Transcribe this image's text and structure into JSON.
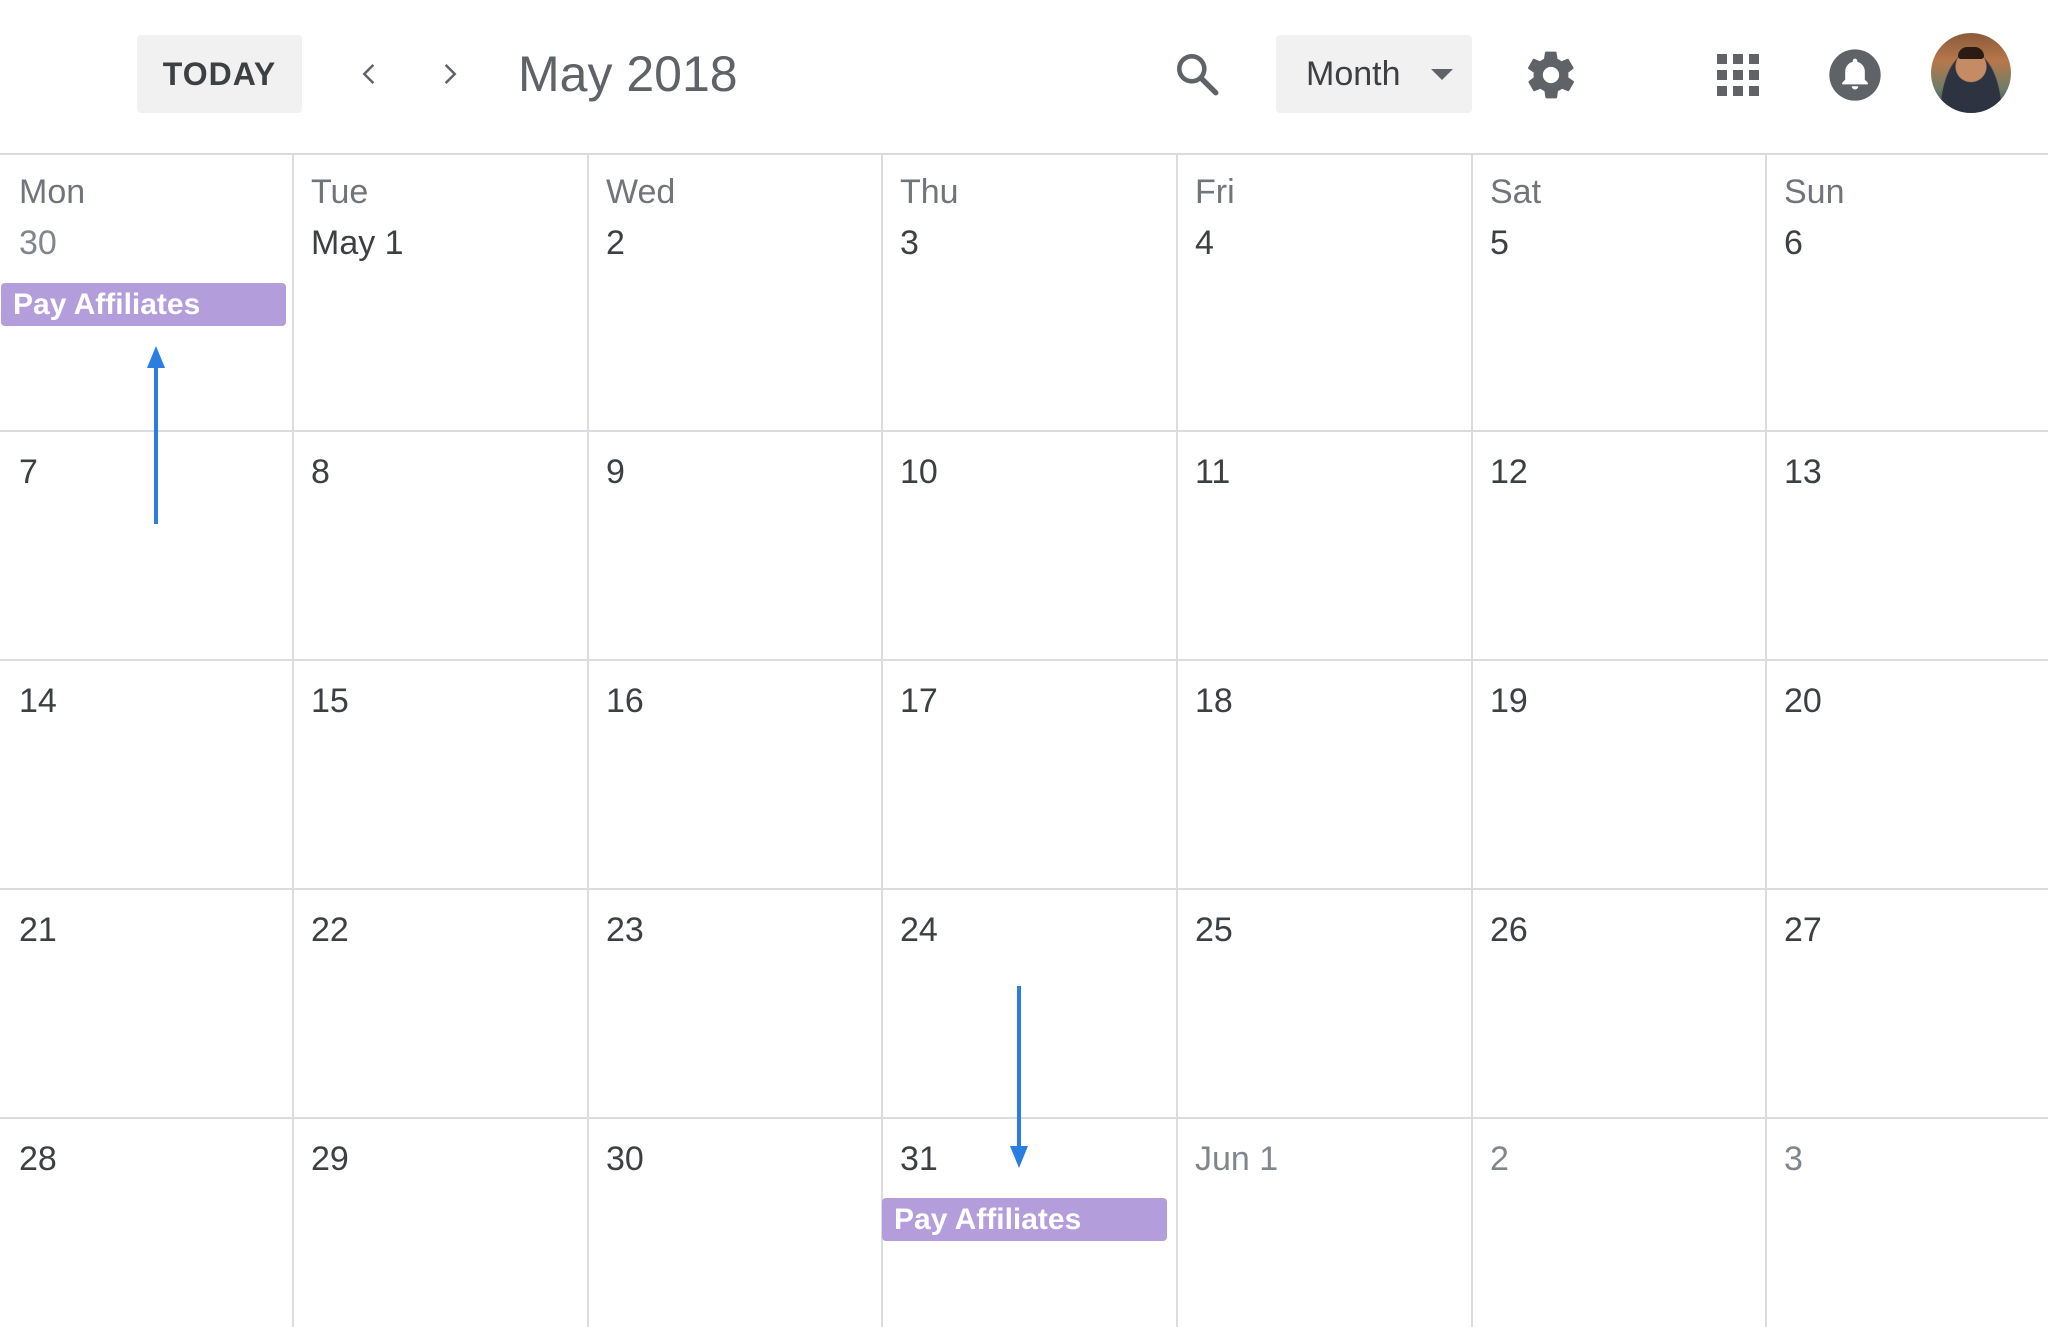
{
  "toolbar": {
    "today_label": "TODAY",
    "period_title": "May 2018",
    "view": {
      "selected": "Month"
    },
    "icons": {
      "prev": "chevron-left-icon",
      "next": "chevron-right-icon",
      "search": "search-icon",
      "dropdown": "caret-down-icon",
      "settings": "gear-icon",
      "apps": "apps-grid-icon",
      "notifications": "bell-icon"
    }
  },
  "weekdays": [
    "Mon",
    "Tue",
    "Wed",
    "Thu",
    "Fri",
    "Sat",
    "Sun"
  ],
  "weeks": [
    [
      {
        "label": "30",
        "muted": true
      },
      {
        "label": "May 1",
        "muted": false
      },
      {
        "label": "2",
        "muted": false
      },
      {
        "label": "3",
        "muted": false
      },
      {
        "label": "4",
        "muted": false
      },
      {
        "label": "5",
        "muted": false
      },
      {
        "label": "6",
        "muted": false
      }
    ],
    [
      {
        "label": "7",
        "muted": false
      },
      {
        "label": "8",
        "muted": false
      },
      {
        "label": "9",
        "muted": false
      },
      {
        "label": "10",
        "muted": false
      },
      {
        "label": "11",
        "muted": false
      },
      {
        "label": "12",
        "muted": false
      },
      {
        "label": "13",
        "muted": false
      }
    ],
    [
      {
        "label": "14",
        "muted": false
      },
      {
        "label": "15",
        "muted": false
      },
      {
        "label": "16",
        "muted": false
      },
      {
        "label": "17",
        "muted": false
      },
      {
        "label": "18",
        "muted": false
      },
      {
        "label": "19",
        "muted": false
      },
      {
        "label": "20",
        "muted": false
      }
    ],
    [
      {
        "label": "21",
        "muted": false
      },
      {
        "label": "22",
        "muted": false
      },
      {
        "label": "23",
        "muted": false
      },
      {
        "label": "24",
        "muted": false
      },
      {
        "label": "25",
        "muted": false
      },
      {
        "label": "26",
        "muted": false
      },
      {
        "label": "27",
        "muted": false
      }
    ],
    [
      {
        "label": "28",
        "muted": false
      },
      {
        "label": "29",
        "muted": false
      },
      {
        "label": "30",
        "muted": false
      },
      {
        "label": "31",
        "muted": false
      },
      {
        "label": "Jun 1",
        "muted": true
      },
      {
        "label": "2",
        "muted": true
      },
      {
        "label": "3",
        "muted": true
      }
    ]
  ],
  "events": [
    {
      "title": "Pay Affiliates",
      "week": 0,
      "day": 0,
      "color": "#b39ddb"
    },
    {
      "title": "Pay Affiliates",
      "week": 4,
      "day": 3,
      "color": "#b39ddb"
    }
  ],
  "annotation": {
    "arrow_color": "#2a7de1"
  }
}
